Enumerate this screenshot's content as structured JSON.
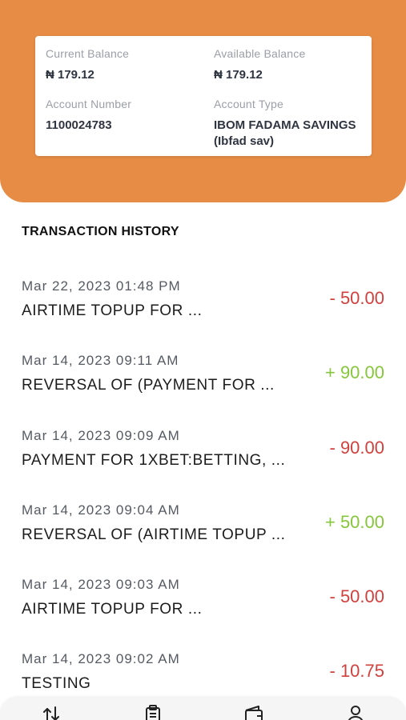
{
  "account": {
    "current_balance_label": "Current Balance",
    "current_balance": "₦ 179.12",
    "available_balance_label": "Available Balance",
    "available_balance": "₦ 179.12",
    "account_number_label": "Account Number",
    "account_number": "1100024783",
    "account_type_label": "Account Type",
    "account_type": "IBOM FADAMA SAVINGS (Ibfad sav)"
  },
  "history": {
    "title": "TRANSACTION HISTORY",
    "transactions": [
      {
        "date": "Mar 22, 2023 01:48 PM",
        "description": "AIRTIME TOPUP FOR ...",
        "amount": "- 50.00",
        "type": "debit"
      },
      {
        "date": "Mar 14, 2023 09:11 AM",
        "description": "REVERSAL OF (PAYMENT FOR ...",
        "amount": "+ 90.00",
        "type": "credit"
      },
      {
        "date": "Mar 14, 2023 09:09 AM",
        "description": "PAYMENT FOR 1XBET:BETTING, ...",
        "amount": "- 90.00",
        "type": "debit"
      },
      {
        "date": "Mar 14, 2023 09:04 AM",
        "description": "REVERSAL OF (AIRTIME TOPUP ...",
        "amount": "+ 50.00",
        "type": "credit"
      },
      {
        "date": "Mar 14, 2023 09:03 AM",
        "description": "AIRTIME TOPUP FOR ...",
        "amount": "- 50.00",
        "type": "debit"
      },
      {
        "date": "Mar 14, 2023 09:02 AM",
        "description": "TESTING",
        "amount": "- 10.75",
        "type": "debit"
      }
    ]
  },
  "nav": {
    "icons": [
      "transfer-icon",
      "clipboard-icon",
      "wallet-icon",
      "profile-icon"
    ]
  },
  "colors": {
    "header": "#e68c45",
    "debit": "#d0413d",
    "credit": "#86c63b"
  }
}
